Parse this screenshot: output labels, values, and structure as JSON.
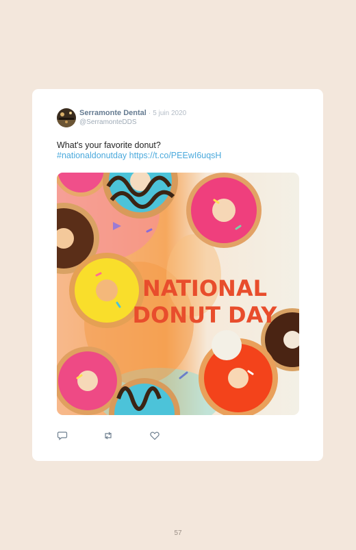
{
  "tweet": {
    "author_name": "Serramonte Dental",
    "separator": "·",
    "date": "5 juin 2020",
    "handle": "@SerramonteDDS",
    "text": "What's your favorite donut?",
    "hashtag": "#nationaldonutday",
    "url": "https://t.co/PEEwI6uqsH",
    "image": {
      "line1": "NATIONAL",
      "line2": "DONUT DAY"
    }
  },
  "actions": {
    "reply_icon": "reply-icon",
    "retweet_icon": "retweet-icon",
    "like_icon": "heart-icon"
  },
  "colors": {
    "page_background": "#f3e7dc",
    "card_background": "#ffffff",
    "link": "#4aa9dc",
    "headline": "#e84d2c"
  },
  "page": {
    "number": "57"
  }
}
